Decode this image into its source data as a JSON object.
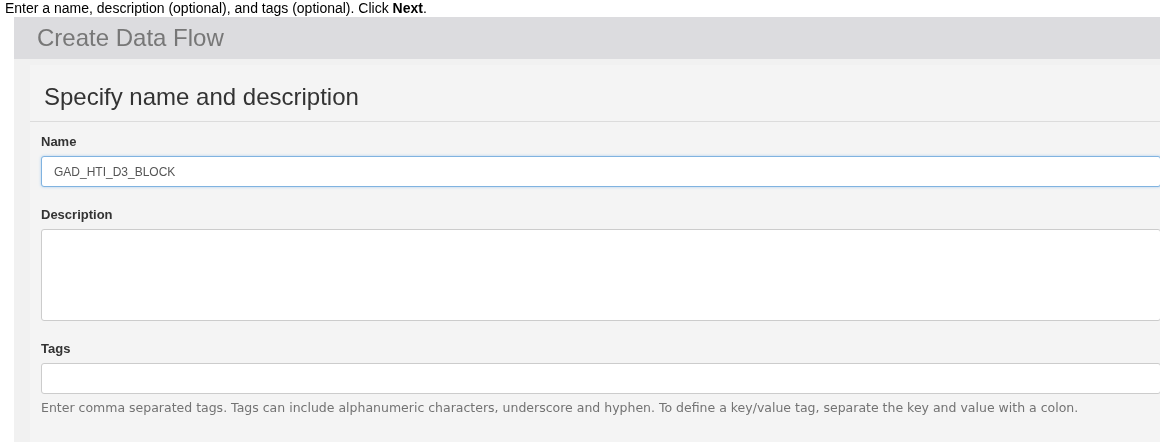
{
  "instruction": "Enter a name, description (optional), and tags (optional). Click **Next**.",
  "window": {
    "title": "Create Data Flow"
  },
  "section": {
    "title": "Specify name and description"
  },
  "fields": [
    {
      "label": "Name",
      "kind": "text",
      "value": "GAD_HTI_D3_BLOCK",
      "focused": true
    },
    {
      "label": "Description",
      "kind": "textarea",
      "focused": false
    },
    {
      "label": "Tags",
      "kind": "text",
      "focused": false,
      "help": "Enter comma separated tags. Tags can include alphanumeric characters, underscore and hyphen. To define a key/value tag, separate the key and value with a colon."
    }
  ]
}
